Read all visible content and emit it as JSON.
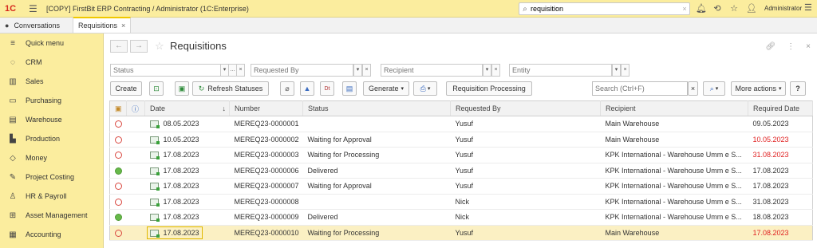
{
  "app": {
    "logo": "1C",
    "title": "[COPY] FirstBit ERP Contracting / Administrator  (1C:Enterprise)",
    "search_value": "requisition",
    "user": "Administrator"
  },
  "tabs": [
    {
      "label": "Conversations"
    },
    {
      "label": "Requisitions",
      "close": "×"
    }
  ],
  "sidebar": {
    "items": [
      {
        "label": "Quick menu",
        "icon": "menu-icon"
      },
      {
        "label": "CRM",
        "icon": "chat-icon"
      },
      {
        "label": "Sales",
        "icon": "shop-icon"
      },
      {
        "label": "Purchasing",
        "icon": "truck-icon"
      },
      {
        "label": "Warehouse",
        "icon": "warehouse-icon"
      },
      {
        "label": "Production",
        "icon": "factory-icon"
      },
      {
        "label": "Money",
        "icon": "money-icon"
      },
      {
        "label": "Project Costing",
        "icon": "pin-icon"
      },
      {
        "label": "HR & Payroll",
        "icon": "person-icon"
      },
      {
        "label": "Asset Management",
        "icon": "asset-icon"
      },
      {
        "label": "Accounting",
        "icon": "calculator-icon"
      }
    ]
  },
  "page": {
    "title": "Requisitions"
  },
  "filters": {
    "status_placeholder": "Status",
    "requested_by_placeholder": "Requested By",
    "recipient_placeholder": "Recipient",
    "entity_placeholder": "Entity"
  },
  "toolbar": {
    "create": "Create",
    "refresh": "Refresh Statuses",
    "generate": "Generate",
    "requisition_processing": "Requisition Processing",
    "search_placeholder": "Search (Ctrl+F)",
    "more_actions": "More actions",
    "help": "?"
  },
  "table": {
    "columns": [
      "Date",
      "Number",
      "Status",
      "Requested By",
      "Recipient",
      "Required Date"
    ],
    "rows": [
      {
        "state": "open",
        "date": "08.05.2023",
        "number": "MEREQ23-0000001",
        "status": "",
        "requested_by": "Yusuf",
        "recipient": "Main Warehouse",
        "required_date": "09.05.2023",
        "overdue": false
      },
      {
        "state": "open",
        "date": "10.05.2023",
        "number": "MEREQ23-0000002",
        "status": "Waiting for Approval",
        "requested_by": "Yusuf",
        "recipient": "Main Warehouse",
        "required_date": "10.05.2023",
        "overdue": true
      },
      {
        "state": "open",
        "date": "17.08.2023",
        "number": "MEREQ23-0000003",
        "status": "Waiting for Processing",
        "requested_by": "Yusuf",
        "recipient": "KPK International - Warehouse Umm e S...",
        "required_date": "31.08.2023",
        "overdue": true
      },
      {
        "state": "done",
        "date": "17.08.2023",
        "number": "MEREQ23-0000006",
        "status": "Delivered",
        "requested_by": "Yusuf",
        "recipient": "KPK International - Warehouse Umm e S...",
        "required_date": "17.08.2023",
        "overdue": false
      },
      {
        "state": "open",
        "date": "17.08.2023",
        "number": "MEREQ23-0000007",
        "status": "Waiting for Approval",
        "requested_by": "Yusuf",
        "recipient": "KPK International - Warehouse Umm e S...",
        "required_date": "17.08.2023",
        "overdue": false
      },
      {
        "state": "open",
        "date": "17.08.2023",
        "number": "MEREQ23-0000008",
        "status": "",
        "requested_by": "Nick",
        "recipient": "KPK International - Warehouse Umm e S...",
        "required_date": "31.08.2023",
        "overdue": false
      },
      {
        "state": "done",
        "date": "17.08.2023",
        "number": "MEREQ23-0000009",
        "status": "Delivered",
        "requested_by": "Nick",
        "recipient": "KPK International - Warehouse Umm e S...",
        "required_date": "18.08.2023",
        "overdue": false
      },
      {
        "state": "open",
        "date": "17.08.2023",
        "number": "MEREQ23-0000010",
        "status": "Waiting for Processing",
        "requested_by": "Yusuf",
        "recipient": "Main Warehouse",
        "required_date": "17.08.2023",
        "overdue": true,
        "selected": true
      }
    ]
  }
}
